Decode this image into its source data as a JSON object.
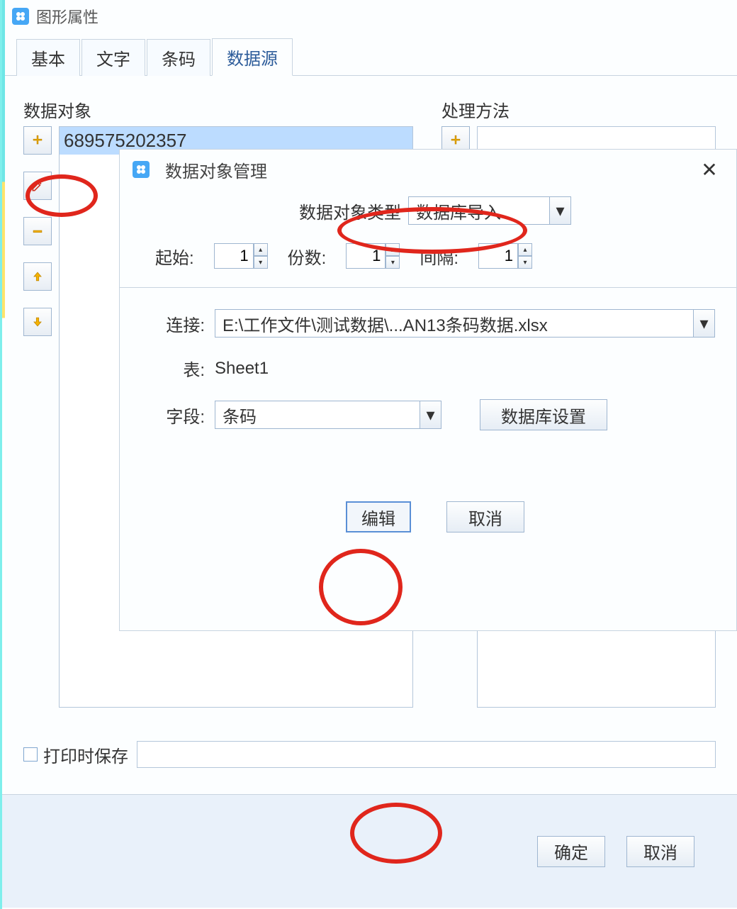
{
  "window": {
    "title": "图形属性"
  },
  "tabs": {
    "basic": "基本",
    "text": "文字",
    "barcode": "条码",
    "datasrc": "数据源"
  },
  "left_panel": {
    "label": "数据对象",
    "listValue": "689575202357"
  },
  "right_panel": {
    "label": "处理方法"
  },
  "print_save": {
    "label": "打印时保存"
  },
  "footer": {
    "ok": "确定",
    "cancel": "取消"
  },
  "dialog": {
    "title": "数据对象管理",
    "type_label": "数据对象类型",
    "type_value": "数据库导入",
    "start_label": "起始:",
    "start_value": "1",
    "copies_label": "份数:",
    "copies_value": "1",
    "interval_label": "间隔:",
    "interval_value": "1",
    "conn_label": "连接:",
    "conn_value": "E:\\工作文件\\测试数据\\...AN13条码数据.xlsx",
    "table_label": "表:",
    "table_value": "Sheet1",
    "field_label": "字段:",
    "field_value": "条码",
    "db_settings": "数据库设置",
    "edit": "编辑",
    "cancel": "取消"
  }
}
